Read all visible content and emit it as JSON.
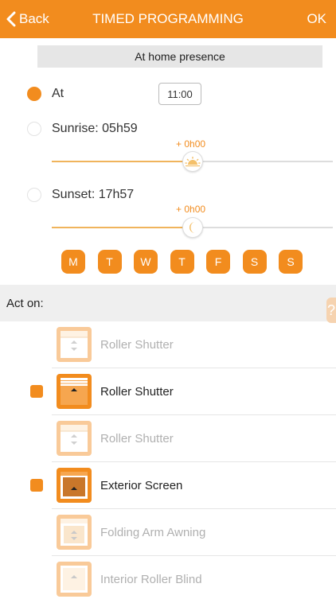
{
  "nav": {
    "back_label": "Back",
    "title": "TIMED PROGRAMMING",
    "ok_label": "OK"
  },
  "presence": "At home presence",
  "schedule": {
    "at_label": "At",
    "at_time": "11:00",
    "sunrise_label": "Sunrise: 05h59",
    "sunrise_offset": "+ 0h00",
    "sunset_label": "Sunset: 17h57",
    "sunset_offset": "+ 0h00",
    "selected": "at"
  },
  "days": [
    "M",
    "T",
    "W",
    "T",
    "F",
    "S",
    "S"
  ],
  "act_on": {
    "label": "Act on:",
    "help_glyph": "?",
    "devices": [
      {
        "name": "Roller Shutter",
        "checked": false,
        "icon": "roller-shutter-icon"
      },
      {
        "name": "Roller Shutter",
        "checked": true,
        "icon": "roller-shutter-icon"
      },
      {
        "name": "Roller Shutter",
        "checked": false,
        "icon": "roller-shutter-icon"
      },
      {
        "name": "Exterior Screen",
        "checked": true,
        "icon": "exterior-screen-icon"
      },
      {
        "name": "Folding Arm Awning",
        "checked": false,
        "icon": "folding-arm-awning-icon"
      },
      {
        "name": "Interior Roller Blind",
        "checked": false,
        "icon": "interior-roller-blind-icon"
      }
    ]
  },
  "colors": {
    "accent": "#f28c1e",
    "accent_light": "#f0b45c",
    "section_bg": "#efefef"
  }
}
